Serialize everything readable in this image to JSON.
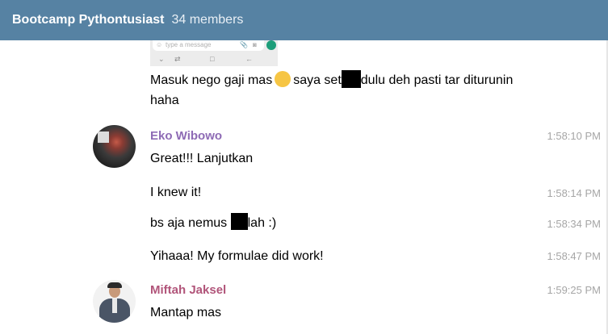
{
  "header": {
    "title": "Bootcamp Pythontusiast",
    "members": "34 members"
  },
  "preview": {
    "placeholder": "type a message",
    "smiley": "☺",
    "clip": "📎",
    "camera": "◙",
    "nav_down": "⌄",
    "nav_rotate": "⇄",
    "nav_home": "□",
    "nav_back": "←"
  },
  "messages": {
    "m1_line1_before": "Masuk nego gaji mas",
    "m1_line1_mid": "saya set",
    "m1_line1_after": "dulu deh pasti tar diturunin",
    "m1_line2": "haha",
    "eko_name": "Eko Wibowo",
    "eko_time": "1:58:10 PM",
    "eko_text": "Great!!! Lanjutkan",
    "m3_text": "I knew it!",
    "m3_time": "1:58:14 PM",
    "m4_before": "bs aja nemus",
    "m4_after": "lah :)",
    "m4_time": "1:58:34 PM",
    "m5_text": "Yihaaa! My formulae did work!",
    "m5_time": "1:58:47 PM",
    "miftah_name": "Miftah Jaksel",
    "miftah_time": "1:59:25 PM",
    "miftah_text": "Mantap mas"
  },
  "colors": {
    "header_bg": "#5682a3",
    "eko_name": "#8e6bb5",
    "miftah_name": "#b1557a",
    "timestamp": "#a6a6a6"
  },
  "icons": [
    "smiley-emoji-icon",
    "paperclip-icon",
    "camera-icon",
    "mic-icon"
  ]
}
